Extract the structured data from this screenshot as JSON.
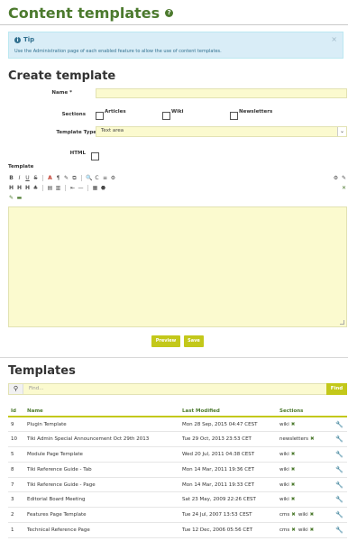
{
  "page": {
    "title": "Content templates"
  },
  "tip": {
    "heading": "Tip",
    "text": "Use the Administration page of each enabled feature to allow the use of content templates.",
    "close": "×"
  },
  "create": {
    "heading": "Create template",
    "name_label": "Name *",
    "name_value": "",
    "sections_label": "Sections",
    "sections": [
      {
        "label": "Articles"
      },
      {
        "label": "Wiki"
      },
      {
        "label": "Newsletters"
      }
    ],
    "type_label": "Template Type",
    "type_value": "Text area",
    "html_label": "HTML",
    "template_label": "Template",
    "preview_label": "Preview",
    "save_label": "Save"
  },
  "toolbar": {
    "row1": [
      "B",
      "I",
      "U",
      "S",
      "A",
      "¶",
      "✎",
      "⧉",
      "🔍",
      "C",
      "≡",
      "⚙"
    ],
    "row2": [
      "H",
      "H",
      "H",
      "♣",
      "▤",
      "▥",
      "⇤",
      "—",
      "▦",
      "⬣"
    ],
    "row3": [
      "✎",
      "▬"
    ]
  },
  "templates": {
    "heading": "Templates",
    "search_placeholder": "Find...",
    "find_label": "Find",
    "columns": {
      "id": "Id",
      "name": "Name",
      "modified": "Last Modified",
      "sections": "Sections"
    },
    "rows": [
      {
        "id": "9",
        "name": "Plugin Template",
        "modified": "Mon 28 Sep, 2015 04:47 CEST",
        "sections": [
          "wiki"
        ]
      },
      {
        "id": "10",
        "name": "Tiki Admin Special Announcement Oct 29th 2013",
        "modified": "Tue 29 Oct, 2013 23:53 CET",
        "sections": [
          "newsletters"
        ]
      },
      {
        "id": "5",
        "name": "Module Page Template",
        "modified": "Wed 20 Jul, 2011 04:38 CEST",
        "sections": [
          "wiki"
        ]
      },
      {
        "id": "8",
        "name": "Tiki Reference Guide - Tab",
        "modified": "Mon 14 Mar, 2011 19:36 CET",
        "sections": [
          "wiki"
        ]
      },
      {
        "id": "7",
        "name": "Tiki Reference Guide - Page",
        "modified": "Mon 14 Mar, 2011 19:33 CET",
        "sections": [
          "wiki"
        ]
      },
      {
        "id": "3",
        "name": "Editorial Board Meeting",
        "modified": "Sat 23 May, 2009 22:26 CEST",
        "sections": [
          "wiki"
        ]
      },
      {
        "id": "2",
        "name": "Features Page Template",
        "modified": "Tue 24 Jul, 2007 13:53 CEST",
        "sections": [
          "cms",
          "wiki"
        ]
      },
      {
        "id": "1",
        "name": "Technical Reference Page",
        "modified": "Tue 12 Dec, 2006 05:56 CET",
        "sections": [
          "cms",
          "wiki"
        ]
      }
    ]
  },
  "colors": {
    "accent_green": "#4c7a2e",
    "button_olive": "#c3c81a",
    "input_yellow": "#fbfacf",
    "tip_blue": "#d9edf7"
  }
}
